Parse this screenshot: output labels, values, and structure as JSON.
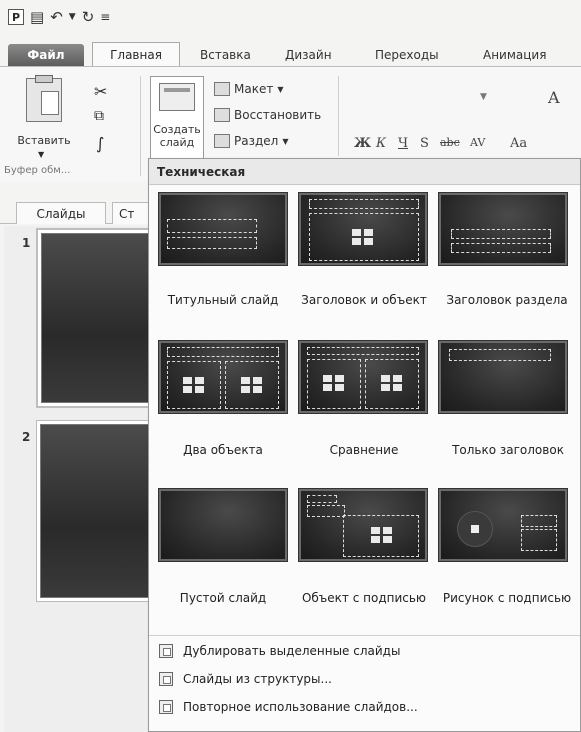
{
  "quick_access": {
    "app_icon": "P",
    "save_icon": "save-icon",
    "undo_icon": "undo-icon",
    "redo_icon": "redo-icon",
    "customize_icon": "customize-icon"
  },
  "ribbon_tabs": {
    "file": "Файл",
    "items": [
      "Главная",
      "Вставка",
      "Дизайн",
      "Переходы",
      "Анимация"
    ]
  },
  "clipboard": {
    "paste": "Вставить",
    "group_label": "Буфер обм..."
  },
  "slides_group": {
    "new_slide": "Создать\nслайд",
    "layout": "Макет",
    "reset": "Восстановить",
    "section": "Раздел"
  },
  "font_group": {
    "bold": "Ж",
    "italic": "К",
    "underline": "Ч",
    "shadow": "S",
    "strike": "abc",
    "spacing": "AV",
    "case": "Aa",
    "grow": "A"
  },
  "left_pane": {
    "tabs": [
      "Слайды",
      "Ст"
    ],
    "slides": [
      "1",
      "2"
    ]
  },
  "gallery": {
    "theme_title": "Техническая",
    "layouts": [
      {
        "label": "Титульный слайд"
      },
      {
        "label": "Заголовок и объект"
      },
      {
        "label": "Заголовок раздела"
      },
      {
        "label": "Два объекта"
      },
      {
        "label": "Сравнение"
      },
      {
        "label": "Только заголовок"
      },
      {
        "label": "Пустой слайд"
      },
      {
        "label": "Объект с подписью"
      },
      {
        "label": "Рисунок с подписью"
      }
    ],
    "commands": [
      "Дублировать выделенные слайды",
      "Слайды из структуры...",
      "Повторное использование слайдов..."
    ]
  }
}
